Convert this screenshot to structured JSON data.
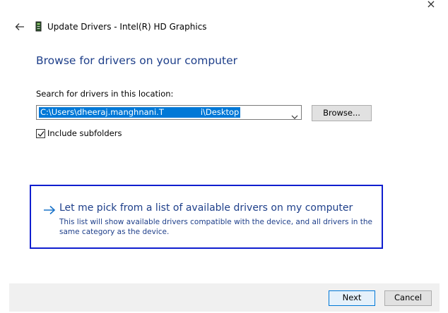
{
  "window": {
    "title": "Update Drivers - Intel(R) HD Graphics",
    "close_glyph": "×"
  },
  "page": {
    "heading": "Browse for drivers on your computer",
    "search_label": "Search for drivers in this location:",
    "path_value_start": "C:\\Users\\dheeraj.manghnani.T",
    "path_value_end": "i\\Desktop",
    "browse_label": "Browse...",
    "include_subfolders_label": "Include subfolders",
    "include_subfolders_checked": true
  },
  "pick_option": {
    "title": "Let me pick from a list of available drivers on my computer",
    "description": "This list will show available drivers compatible with the device, and all drivers in the same category as the device."
  },
  "footer": {
    "next_label": "Next",
    "cancel_label": "Cancel"
  },
  "colors": {
    "accent_text": "#1e3f8a",
    "selection": "#0078d7",
    "focus_border": "#0f1ecf"
  },
  "icons": {
    "back": "back-arrow-icon",
    "device": "display-adapter-icon",
    "close": "close-icon",
    "chevron": "chevron-down-icon",
    "check": "checkmark-icon",
    "pick_arrow": "right-arrow-icon"
  }
}
